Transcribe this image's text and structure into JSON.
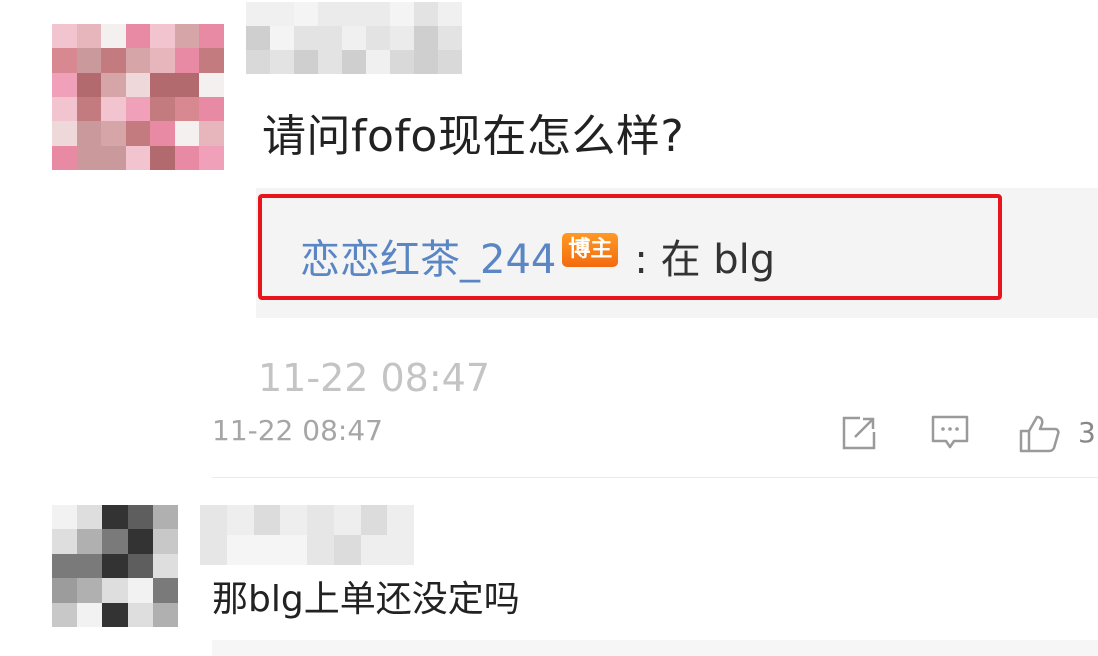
{
  "comments": [
    {
      "avatar": {
        "blurred": true,
        "palette": [
          "#f5f0f0",
          "#d6a5a8",
          "#c47b80",
          "#b36a6f",
          "#e98aa5",
          "#f0a0b8",
          "#d88890",
          "#c9999c",
          "#eed8da",
          "#bb7075",
          "#f2c4cf",
          "#e7b6bc"
        ]
      },
      "username": {
        "blurred": true,
        "palette": [
          "#f4f4f4",
          "#e3e3e3",
          "#d9d9d9",
          "#ebebeb",
          "#cfcfcf",
          "#f0f0f0"
        ]
      },
      "text": "请问fofo现在怎么样?",
      "reply": {
        "author": "恋恋红茶_244",
        "badge": "博主",
        "text": ": 在 blg",
        "highlight_color": "#e8161c"
      },
      "ghost_timestamp": "11-22 08:47",
      "timestamp": "11-22 08:47",
      "actions": {
        "share_icon": "share-icon",
        "comment_icon": "comment-icon",
        "like_icon": "thumbs-up-icon",
        "like_count": "3"
      }
    },
    {
      "avatar": {
        "blurred": true,
        "palette": [
          "#f2f2f2",
          "#c8c8c8",
          "#9c9c9c",
          "#5e5e5e",
          "#333333",
          "#dedede",
          "#7a7a7a",
          "#b0b0b0"
        ]
      },
      "username": {
        "blurred": true,
        "palette": [
          "#f5f5f5",
          "#e6e6e6",
          "#dcdcdc",
          "#eeeeee"
        ]
      },
      "text": "那blg上单还没定吗"
    }
  ]
}
